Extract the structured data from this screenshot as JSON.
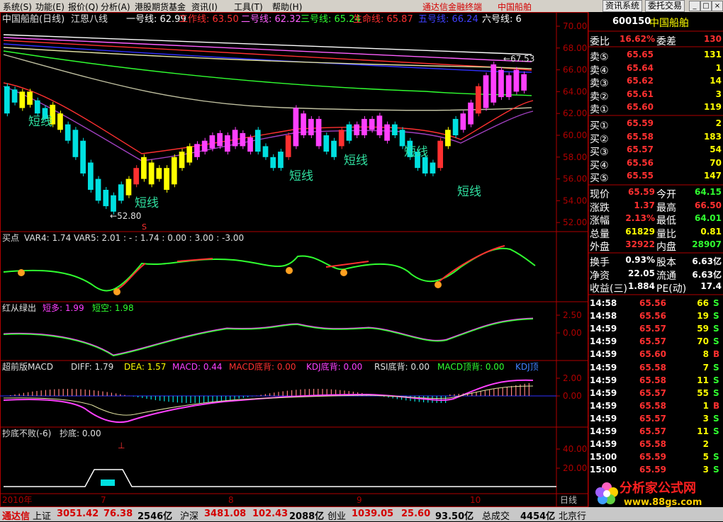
{
  "menu": {
    "items": [
      "系统(S)",
      "功能(E)",
      "报价(Q)",
      "分析(A)",
      "港股期货基金",
      "资讯(I)",
      "工具(T)",
      "帮助(H)"
    ],
    "app_title": "通达信金融终端",
    "stock_title": "中国船舶",
    "btn_info": "资讯系统",
    "btn_trade": "委托交易"
  },
  "main_chart": {
    "title": "中国船舶(日线)",
    "indicator": "江恩八线",
    "lines": [
      {
        "label": "一号线:",
        "value": "62.99",
        "color": "#ffffff"
      },
      {
        "label": "工作线:",
        "value": "63.50",
        "color": "#ff3030"
      },
      {
        "label": "二号线:",
        "value": "62.32",
        "color": "#ff60ff"
      },
      {
        "label": "三号线:",
        "value": "65.24",
        "color": "#30ff30"
      },
      {
        "label": "生命线:",
        "value": "65.87",
        "color": "#ff3030"
      },
      {
        "label": "五号线:",
        "value": "66.24",
        "color": "#4040ff"
      },
      {
        "label": "六号线:",
        "value": "6",
        "color": "#ffffff"
      }
    ],
    "y_ticks": [
      "70.00",
      "68.00",
      "66.00",
      "64.00",
      "62.00",
      "60.00",
      "58.00",
      "56.00",
      "54.00",
      "52.00"
    ],
    "annotations": [
      "短线",
      "短线",
      "短线",
      "短线",
      "短线",
      "短线"
    ],
    "high_marker": "67.53",
    "low_marker": "52.80",
    "s_marker": "S"
  },
  "sub1": {
    "name": "买点",
    "text": "VAR4: 1.74 VAR5: 2.01 : - : 1.74  : 0.00 : 3.00 : -3.00"
  },
  "sub2": {
    "name": "红从绿出",
    "short_more": "短多: 1.99",
    "short_empty": "短空: 1.98",
    "y_ticks": [
      "2.50",
      "0.00"
    ]
  },
  "sub3": {
    "name": "超前版MACD",
    "diff": "DIFF: 1.79",
    "dea": "DEA: 1.57",
    "macd": "MACD: 0.44",
    "macd_bottom": "MACD底背: 0.00",
    "kdj_bottom": "KDJ底背: 0.00",
    "rsi_bottom": "RSI底背: 0.00",
    "macd_top": "MACD顶背: 0.00",
    "kdj_top": "KDJ顶",
    "y_ticks": [
      "2.00",
      "0.00"
    ]
  },
  "sub4": {
    "name": "抄底不败(-6)",
    "text": "抄底: 0.00",
    "y_ticks": [
      "40.00",
      "20.00"
    ]
  },
  "x_axis": {
    "labels": [
      "2010年",
      "7",
      "8",
      "9",
      "10"
    ],
    "period": "日线"
  },
  "panel": {
    "code": "600150",
    "name": "中国船舶",
    "weibi_label": "委比",
    "weibi": "16.62%",
    "weicha_label": "委差",
    "weicha": "130",
    "asks": [
      {
        "label": "卖⑤",
        "price": "65.65",
        "vol": "131"
      },
      {
        "label": "卖④",
        "price": "65.64",
        "vol": "1"
      },
      {
        "label": "卖③",
        "price": "65.62",
        "vol": "14"
      },
      {
        "label": "卖②",
        "price": "65.61",
        "vol": "3"
      },
      {
        "label": "卖①",
        "price": "65.60",
        "vol": "119"
      }
    ],
    "bids": [
      {
        "label": "买①",
        "price": "65.59",
        "vol": "2"
      },
      {
        "label": "买②",
        "price": "65.58",
        "vol": "183"
      },
      {
        "label": "买③",
        "price": "65.57",
        "vol": "54"
      },
      {
        "label": "买④",
        "price": "65.56",
        "vol": "70"
      },
      {
        "label": "买⑤",
        "price": "65.55",
        "vol": "147"
      }
    ],
    "stats": [
      {
        "l1": "现价",
        "v1": "65.59",
        "c1": "#ff3030",
        "l2": "今开",
        "v2": "64.15",
        "c2": "#30ff30"
      },
      {
        "l1": "涨跌",
        "v1": "1.37",
        "c1": "#ff3030",
        "l2": "最高",
        "v2": "66.50",
        "c2": "#ff3030"
      },
      {
        "l1": "涨幅",
        "v1": "2.13%",
        "c1": "#ff3030",
        "l2": "最低",
        "v2": "64.01",
        "c2": "#30ff30"
      },
      {
        "l1": "总量",
        "v1": "61829",
        "c1": "#ffff00",
        "l2": "量比",
        "v2": "0.81",
        "c2": "#ffff00"
      },
      {
        "l1": "外盘",
        "v1": "32922",
        "c1": "#ff3030",
        "l2": "内盘",
        "v2": "28907",
        "c2": "#30ff30"
      }
    ],
    "stats2": [
      {
        "l1": "换手",
        "v1": "0.93%",
        "l2": "股本",
        "v2": "6.63亿"
      },
      {
        "l1": "净资",
        "v1": "22.05",
        "l2": "流通",
        "v2": "6.63亿"
      },
      {
        "l1": "收益(三)",
        "v1": "1.884",
        "l2": "PE(动)",
        "v2": "17.4"
      }
    ],
    "ticks": [
      {
        "t": "14:58",
        "p": "65.56",
        "v": "66",
        "s": "S"
      },
      {
        "t": "14:58",
        "p": "65.56",
        "v": "19",
        "s": "S"
      },
      {
        "t": "14:59",
        "p": "65.57",
        "v": "59",
        "s": "S"
      },
      {
        "t": "14:59",
        "p": "65.57",
        "v": "70",
        "s": "S"
      },
      {
        "t": "14:59",
        "p": "65.60",
        "v": "8",
        "s": "B"
      },
      {
        "t": "14:59",
        "p": "65.58",
        "v": "7",
        "s": "S"
      },
      {
        "t": "14:59",
        "p": "65.58",
        "v": "11",
        "s": "S"
      },
      {
        "t": "14:59",
        "p": "65.57",
        "v": "55",
        "s": "S"
      },
      {
        "t": "14:59",
        "p": "65.58",
        "v": "1",
        "s": "B"
      },
      {
        "t": "14:59",
        "p": "65.57",
        "v": "3",
        "s": "S"
      },
      {
        "t": "14:59",
        "p": "65.57",
        "v": "11",
        "s": "S"
      },
      {
        "t": "14:59",
        "p": "65.58",
        "v": "2",
        "s": ""
      },
      {
        "t": "15:00",
        "p": "65.59",
        "v": "5",
        "s": "S"
      },
      {
        "t": "15:00",
        "p": "65.59",
        "v": "3",
        "s": "S"
      }
    ]
  },
  "bottom": {
    "brand": "通达信",
    "sh_label": "上证",
    "sh": "3051.42",
    "sh_chg": "76.38",
    "sh_amt": "2546亿",
    "hs_label": "沪深",
    "hs": "3481.08",
    "hs_chg": "102.43",
    "hs_amt": "2088亿",
    "cy_label": "创业",
    "cy": "1039.05",
    "cy_chg": "25.60",
    "cy_amt": "93.50亿",
    "total_label": "总成交",
    "total": "4454亿",
    "city": "北京行"
  },
  "watermark": {
    "name": "分析家公式网",
    "url": "www.88gs.com"
  },
  "colors": {
    "up": "#ff3030",
    "down": "#00e0e0",
    "yellow": "#ffff00",
    "magenta": "#ff40ff",
    "green": "#30ff30",
    "axis": "#b00000"
  }
}
